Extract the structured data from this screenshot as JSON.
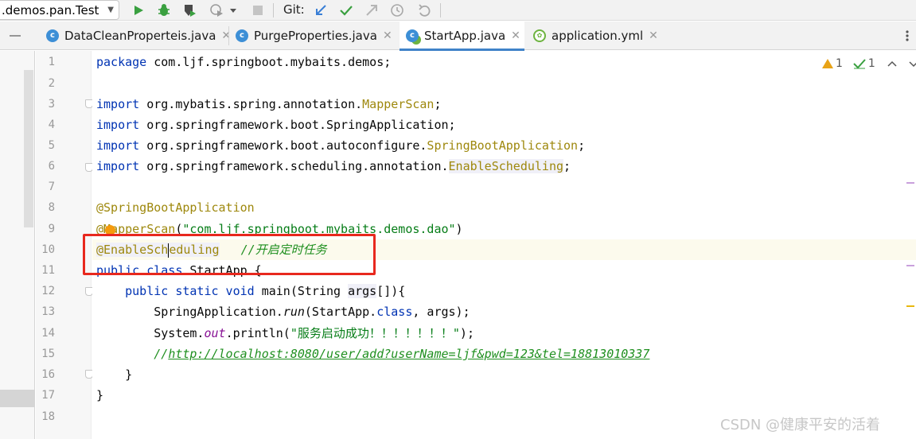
{
  "toolbar": {
    "run_config": ".demos.pan.Test",
    "git_label": "Git:",
    "icons": [
      "dropdown-caret",
      "run",
      "debug",
      "coverage",
      "profiler",
      "stop",
      "vcs-update",
      "vcs-commit",
      "vcs-push",
      "history",
      "rollback"
    ]
  },
  "tabs": [
    {
      "label": "DataCleanProperteis.java",
      "icon": "java-class-icon",
      "active": false
    },
    {
      "label": "PurgeProperties.java",
      "icon": "java-class-icon",
      "active": false
    },
    {
      "label": "StartApp.java",
      "icon": "spring-boot-class-icon",
      "active": true
    },
    {
      "label": "application.yml",
      "icon": "yaml-icon",
      "active": false
    }
  ],
  "inspections": {
    "warnings": "1",
    "weak_warnings": "1"
  },
  "lines": [
    "1",
    "2",
    "3",
    "4",
    "5",
    "6",
    "7",
    "8",
    "9",
    "10",
    "11",
    "12",
    "13",
    "14",
    "15",
    "16",
    "17",
    "18"
  ],
  "code": {
    "l1_kw": "package",
    "l1_rest": " com.ljf.springboot.mybaits.demos;",
    "l3_kw": "import",
    "l3_pkg": " org.mybatis.spring.annotation.",
    "l3_cls": "MapperScan",
    "l4_kw": "import",
    "l4_pkg": " org.springframework.boot.SpringApplication;",
    "l5_kw": "import",
    "l5_pkg": " org.springframework.boot.autoconfigure.",
    "l5_cls": "SpringBootApplication",
    "l6_kw": "import",
    "l6_pkg": " org.springframework.scheduling.annotation.",
    "l6_cls": "EnableScheduling",
    "l8_ann": "@SpringBootApplication",
    "l9_ann_a": "@M",
    "l9_ann_b": "apperScan",
    "l9_str": "\"com.ljf.springboot.mybaits.demos.dao\"",
    "l10_ann_a": "@EnableSch",
    "l10_ann_b": "eduling",
    "l10_cmt": "//开启定时任务",
    "l11_kw": "public class",
    "l11_rest": " StartApp {",
    "l12_kw": "public static void",
    "l12_name": " main(String ",
    "l12_param": "args",
    "l12_end": "[]){",
    "l13_a": "SpringApplication.",
    "l13_run": "run",
    "l13_b": "(StartApp.",
    "l13_cls": "class",
    "l13_c": ", args);",
    "l14_a": "System.",
    "l14_out": "out",
    "l14_b": ".println(",
    "l14_str": "\"服务启动成功！！！！！！！\"",
    "l14_c": ");",
    "l15_prefix": "//",
    "l15_link": "http://localhost:8080/user/add?userName=ljf&pwd=123&tel=18813010337",
    "l16": "}",
    "l17": "}"
  },
  "watermark": "CSDN @健康平安的活着",
  "colors": {
    "highlight_box": "#e8281e",
    "keyword": "#0033b3",
    "annotation": "#9e880d",
    "string": "#067d17",
    "comment": "#1f8f1f"
  }
}
